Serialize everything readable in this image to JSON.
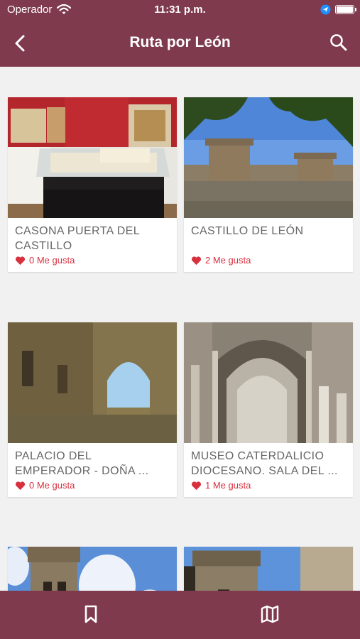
{
  "status": {
    "carrier": "Operador",
    "time": "11:31 p.m."
  },
  "header": {
    "title": "Ruta por León"
  },
  "colors": {
    "brand": "#7f3a4e",
    "like_heart": "#d8313e",
    "background": "#f1f1f1"
  },
  "icons": {
    "back": "chevron-left-icon",
    "search": "search-icon",
    "like": "heart-icon",
    "tab_favorites": "bookmark-icon",
    "tab_map": "map-icon"
  },
  "places": [
    {
      "name": "CASONA PUERTA DEL CASTILLO",
      "likes": "0 Me gusta",
      "image": "museum-exhibit-photo"
    },
    {
      "name": "CASTILLO DE LEÓN",
      "likes": "2 Me gusta",
      "image": "castle-walls-photo"
    },
    {
      "name": "PALACIO DEL EMPERADOR - DOÑA ...",
      "likes": "0 Me gusta",
      "image": "ruined-arch-photo"
    },
    {
      "name": "MUSEO CATERDALICIO DIOCESANO. SALA DEL ...",
      "likes": "1 Me gusta",
      "image": "gothic-cloister-photo"
    },
    {
      "image": "bell-tower-photo"
    },
    {
      "image": "stone-building-photo"
    }
  ]
}
